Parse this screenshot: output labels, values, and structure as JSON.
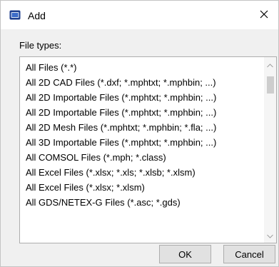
{
  "window": {
    "title": "Add",
    "icon": "dialog-app-icon",
    "close_glyph": "✕"
  },
  "file_types": {
    "label": "File types:",
    "items": [
      "All Files (*.*)",
      "All 2D CAD Files (*.dxf; *.mphtxt; *.mphbin; ...)",
      "All 2D Importable Files (*.mphtxt; *.mphbin; ...)",
      "All 2D Importable Files (*.mphtxt; *.mphbin; ...)",
      "All 2D Mesh Files (*.mphtxt; *.mphbin; *.fla; ...)",
      "All 3D Importable Files (*.mphtxt; *.mphbin; ...)",
      "All COMSOL Files (*.mph; *.class)",
      "All Excel Files (*.xlsx; *.xls; *.xlsb; *.xlsm)",
      "All Excel Files (*.xlsx; *.xlsm)",
      "All GDS/NETEX-G Files (*.asc; *.gds)"
    ]
  },
  "buttons": {
    "ok": "OK",
    "cancel": "Cancel"
  }
}
